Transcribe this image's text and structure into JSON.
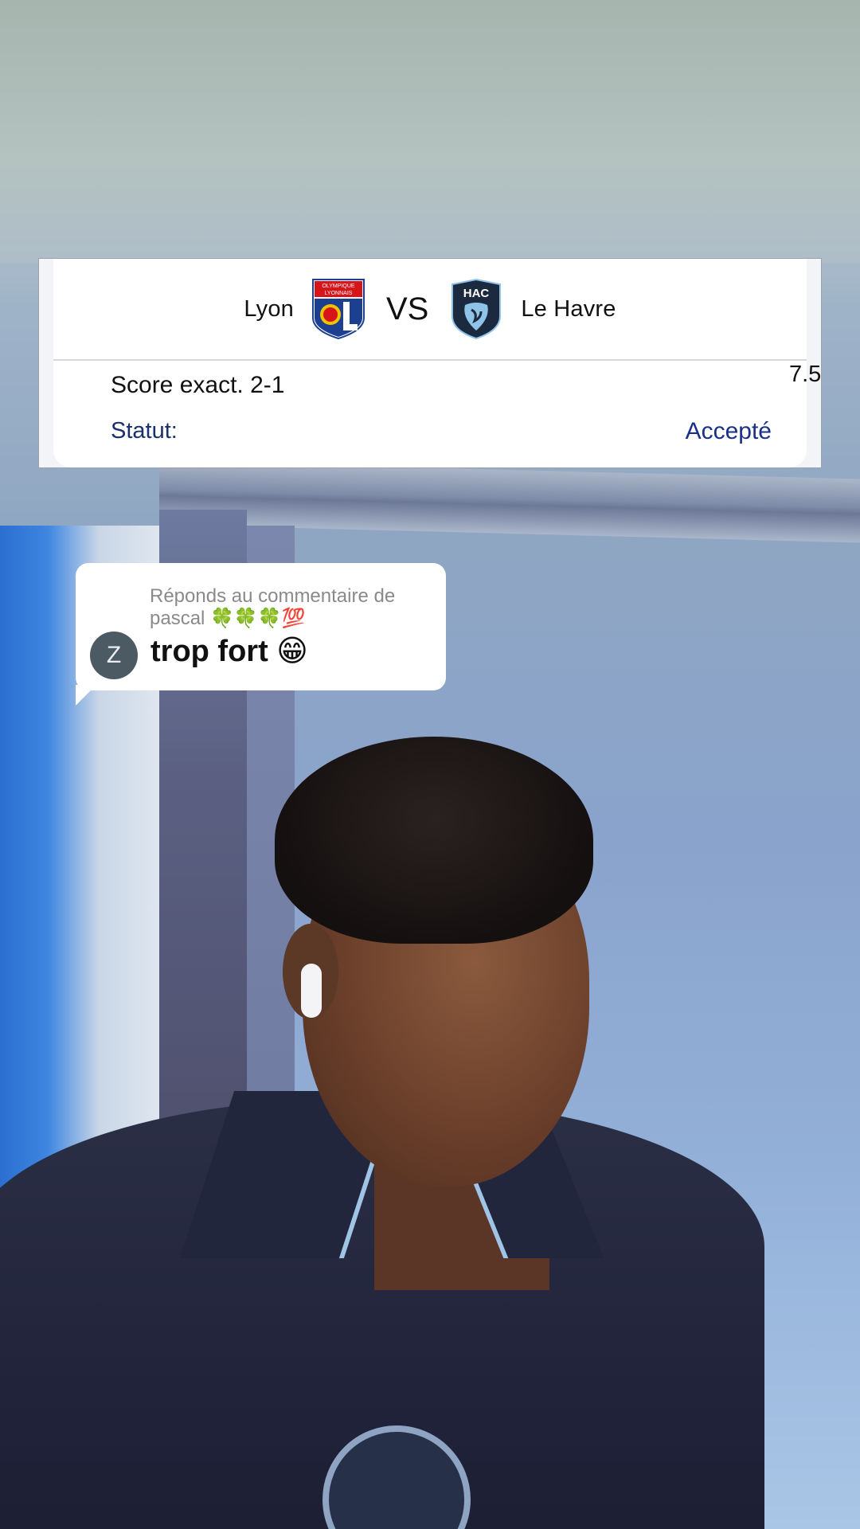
{
  "match": {
    "home_team": "Lyon",
    "away_team": "Le Havre",
    "separator": "VS",
    "home_crest_icon": "olympique-lyonnais-crest-icon",
    "home_crest_text_top": "OLYMPIQUE",
    "home_crest_text_bottom": "LYONNAIS",
    "away_crest_icon": "hac-crest-icon",
    "away_crest_text": "HAC"
  },
  "bet": {
    "label": "Score exact. 2-1",
    "odds": "7.5",
    "status_label": "Statut:",
    "status_value": "Accepté"
  },
  "comment": {
    "reply_header": "Réponds au commentaire de pascal 🍀🍀🍀💯",
    "avatar_initial": "Z",
    "text": "trop fort 😁"
  },
  "colors": {
    "status_blue": "#1a2f8a",
    "lyon_red": "#d7141a",
    "lyon_blue": "#1d3f8f",
    "hac_navy": "#1c2a3f",
    "hac_sky": "#8fc3e8"
  }
}
